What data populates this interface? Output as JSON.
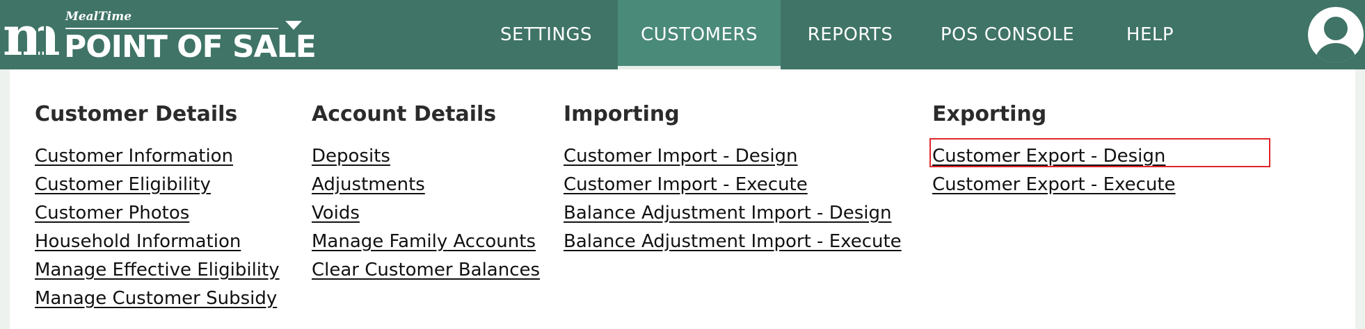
{
  "header": {
    "brand_name": "MealTime",
    "product_name": "POINT OF SALE",
    "logo_mark": "m",
    "colors": {
      "bar": "#3f7466",
      "active_tab": "#4a8a79"
    },
    "tabs": [
      {
        "label": "SETTINGS",
        "active": false
      },
      {
        "label": "CUSTOMERS",
        "active": true
      },
      {
        "label": "REPORTS",
        "active": false
      },
      {
        "label": "POS CONSOLE",
        "active": false
      },
      {
        "label": "HELP",
        "active": false
      }
    ],
    "user_icon": "user-avatar-icon",
    "menu_caret_icon": "caret-down-icon"
  },
  "menu": {
    "columns": [
      {
        "title": "Customer Details",
        "links": [
          "Customer Information",
          "Customer Eligibility",
          "Customer Photos",
          "Household Information",
          "Manage Effective Eligibility",
          "Manage Customer Subsidy"
        ]
      },
      {
        "title": "Account Details",
        "links": [
          "Deposits",
          "Adjustments",
          "Voids",
          "Manage Family Accounts",
          "Clear Customer Balances"
        ]
      },
      {
        "title": "Importing",
        "links": [
          "Customer Import - Design",
          "Customer Import - Execute",
          "Balance Adjustment Import - Design",
          "Balance Adjustment Import - Execute"
        ]
      },
      {
        "title": "Exporting",
        "links": [
          "Customer Export - Design",
          "Customer Export - Execute"
        ]
      }
    ],
    "highlighted_link": "Customer Export - Design",
    "highlight_color": "#e0262a"
  }
}
